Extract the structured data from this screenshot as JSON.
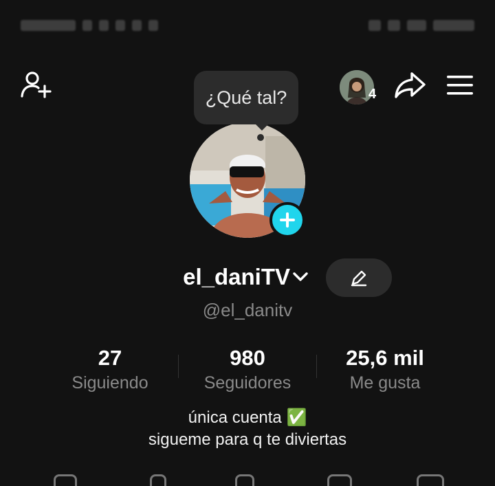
{
  "header": {
    "bubble_text": "¿Qué tal?",
    "notifications_count": "4"
  },
  "profile": {
    "display_name": "el_daniTV",
    "handle": "@el_danitv"
  },
  "stats": [
    {
      "value": "27",
      "label": "Siguiendo"
    },
    {
      "value": "980",
      "label": "Seguidores"
    },
    {
      "value": "25,6 mil",
      "label": "Me gusta"
    }
  ],
  "bio": {
    "line1": "única cuenta ✅",
    "line2": "sigueme para q te diviertas"
  },
  "colors": {
    "background": "#121212",
    "accent": "#20d5ec",
    "secondary_text": "#8a8a8a",
    "button_bg": "#2c2c2c"
  },
  "icons": [
    "add-friend-icon",
    "share-icon",
    "menu-icon",
    "chevron-down-icon",
    "edit-pencil-icon",
    "plus-icon"
  ]
}
